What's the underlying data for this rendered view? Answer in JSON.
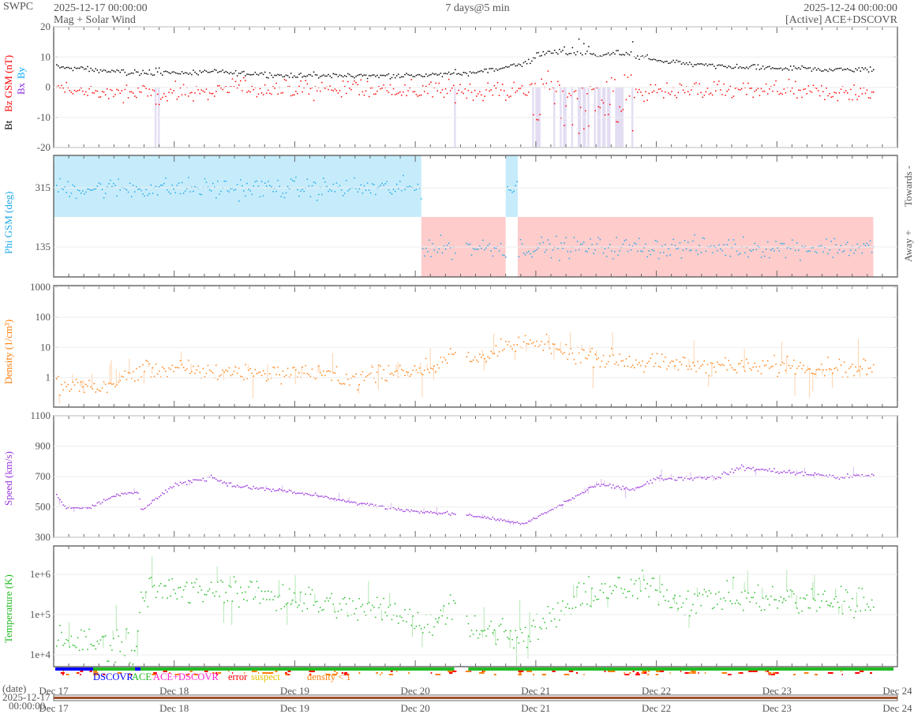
{
  "header": {
    "org": "SWPC",
    "start": "2025-12-17 00:00:00",
    "subtitle": "Mag + Solar Wind",
    "span": "7 days@5 min",
    "end": "2025-12-24 00:00:00",
    "source": "[Active] ACE+DSCOVR"
  },
  "colors": {
    "bt": "#000000",
    "bz": "#ff0000",
    "bx": "#8a2be2",
    "by": "#00aaff",
    "phi": "#1fa8e8",
    "density": "#ff7f0e",
    "speed": "#9933dd",
    "temperature": "#22bb22",
    "toward": "#c6ecfb",
    "away": "#ffcccc",
    "shade": "#ddd6f0"
  },
  "chart_data": [
    {
      "type": "line",
      "name": "mag",
      "ylabel_parts": [
        "Bt",
        "Bz GSM (nT)"
      ],
      "legend_aux": [
        "Bx",
        "By"
      ],
      "ylim": [
        -20,
        20
      ],
      "yticks": [
        "20",
        "10",
        "0",
        "-10",
        "-20"
      ],
      "series": [
        {
          "name": "Bt",
          "t": [
            17,
            17.3,
            17.6,
            18,
            18.5,
            19,
            19.5,
            20,
            20.5,
            20.9,
            21.1,
            21.5,
            21.8,
            22,
            22.5,
            23,
            23.5,
            23.8
          ],
          "values": [
            7,
            6,
            5,
            5,
            5,
            4,
            4,
            4,
            5,
            8,
            12,
            11,
            11,
            9,
            7,
            6.5,
            6,
            6
          ]
        },
        {
          "name": "Bz GSM",
          "t": [
            17,
            17.5,
            18,
            18.5,
            19,
            19.5,
            20,
            20.5,
            20.9,
            21.2,
            21.5,
            21.8,
            22,
            22.5,
            23,
            23.8
          ],
          "values": [
            0,
            -2,
            -2,
            0,
            -1,
            0,
            -1,
            -1,
            -1,
            -4,
            -4,
            -3,
            -1,
            -1,
            -1,
            -2
          ]
        }
      ]
    },
    {
      "type": "scatter",
      "name": "phi",
      "ylabel": "Phi GSM (deg)",
      "yticks": [
        "315",
        "135"
      ],
      "right_labels": [
        "Towards -",
        "Away +"
      ],
      "sectors": [
        {
          "from": 17.0,
          "to": 20.05,
          "sector": "towards"
        },
        {
          "from": 20.05,
          "to": 20.75,
          "sector": "away"
        },
        {
          "from": 20.75,
          "to": 20.85,
          "sector": "towards"
        },
        {
          "from": 20.85,
          "to": 23.8,
          "sector": "away"
        }
      ]
    },
    {
      "type": "line",
      "name": "density",
      "ylabel": "Density (1/cm³)",
      "yscale": "log",
      "ylim": [
        0.1,
        1000
      ],
      "yticks": [
        "1000",
        "100",
        "10",
        "1"
      ],
      "t": [
        17,
        17.3,
        17.6,
        17.7,
        18,
        18.5,
        19,
        19.5,
        20,
        20.2,
        20.33,
        20.45,
        20.9,
        21.5,
        22,
        22.5,
        23,
        23.8
      ],
      "values": [
        0.6,
        0.5,
        1,
        2,
        2,
        1.5,
        1.6,
        1,
        1.8,
        3,
        7,
        4,
        15,
        5,
        3,
        2.5,
        2.5,
        2
      ]
    },
    {
      "type": "line",
      "name": "speed",
      "ylabel": "Speed (km/s)",
      "ylim": [
        300,
        1100
      ],
      "yticks": [
        "1100",
        "900",
        "700",
        "500",
        "300"
      ],
      "t": [
        17,
        17.1,
        17.3,
        17.5,
        17.7,
        17.72,
        18,
        18.3,
        18.5,
        19,
        19.5,
        20,
        20.33,
        20.45,
        20.9,
        21.3,
        21.5,
        21.8,
        22,
        22.5,
        22.7,
        23,
        23.5,
        23.8
      ],
      "values": [
        600,
        500,
        500,
        580,
        600,
        480,
        650,
        700,
        640,
        600,
        530,
        470,
        460,
        450,
        390,
        560,
        650,
        620,
        690,
        700,
        760,
        740,
        700,
        710
      ]
    },
    {
      "type": "line",
      "name": "temperature",
      "ylabel": "Temperature (K)",
      "yscale": "log",
      "ylim": [
        5000,
        5000000
      ],
      "yticks": [
        "1e+6",
        "1e+5",
        "1e+4"
      ],
      "t": [
        17,
        17.3,
        17.6,
        17.68,
        17.72,
        18,
        18.5,
        19,
        19.5,
        19.9,
        20.0,
        20.2,
        20.33,
        20.45,
        20.9,
        21.3,
        21.5,
        22,
        22.2,
        22.5,
        23,
        23.8
      ],
      "values": [
        30000,
        20000,
        20000,
        10000,
        400000,
        400000,
        400000,
        250000,
        150000,
        130000,
        50000,
        100000,
        200000,
        50000,
        30000,
        200000,
        400000,
        500000,
        200000,
        300000,
        250000,
        200000
      ]
    }
  ],
  "status": {
    "legend": [
      "DSCOVR",
      "ACE",
      "ACE+DSCOVR",
      "error",
      "suspect",
      "density < 1"
    ]
  },
  "time_axis": {
    "labels": [
      "Dec 17",
      "Dec 18",
      "Dec 19",
      "Dec 20",
      "Dec 21",
      "Dec 22",
      "Dec 23",
      "Dec 24"
    ],
    "date_caption": "(date)",
    "date_value": "2025-12-17",
    "time_value": "00:00:00",
    "gap": [
      20.33,
      20.42
    ]
  }
}
